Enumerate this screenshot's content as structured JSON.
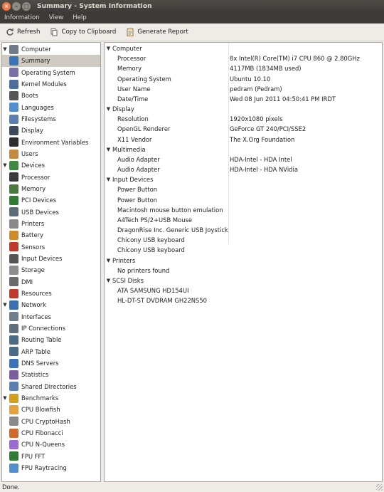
{
  "window": {
    "title": "Summary - System Information",
    "controls": [
      "×",
      "–",
      "□"
    ]
  },
  "menubar": [
    "Information",
    "View",
    "Help"
  ],
  "toolbar": [
    {
      "label": "Refresh",
      "icon": "refresh-icon"
    },
    {
      "label": "Copy to Clipboard",
      "icon": "clipboard-icon"
    },
    {
      "label": "Generate Report",
      "icon": "report-icon"
    }
  ],
  "sidebar": [
    {
      "label": "Computer",
      "level": 0,
      "expanded": true,
      "icon": "computer-icon",
      "color": "#6d7b8d"
    },
    {
      "label": "Summary",
      "level": 1,
      "selected": true,
      "icon": "info-icon",
      "color": "#3b73b9"
    },
    {
      "label": "Operating System",
      "level": 1,
      "icon": "gear-icon",
      "color": "#7a6fa8"
    },
    {
      "label": "Kernel Modules",
      "level": 1,
      "icon": "module-icon",
      "color": "#4b6e9c"
    },
    {
      "label": "Boots",
      "level": 1,
      "icon": "power-icon",
      "color": "#555555"
    },
    {
      "label": "Languages",
      "level": 1,
      "icon": "language-icon",
      "color": "#4f8fd0"
    },
    {
      "label": "Filesystems",
      "level": 1,
      "icon": "folder-icon",
      "color": "#5a7fb3"
    },
    {
      "label": "Display",
      "level": 1,
      "icon": "monitor-icon",
      "color": "#3e4a5c"
    },
    {
      "label": "Environment Variables",
      "level": 1,
      "icon": "terminal-icon",
      "color": "#2e2e2e"
    },
    {
      "label": "Users",
      "level": 1,
      "icon": "users-icon",
      "color": "#c48a3f"
    },
    {
      "label": "Devices",
      "level": 0,
      "expanded": true,
      "icon": "chip-icon",
      "color": "#3f8a3f"
    },
    {
      "label": "Processor",
      "level": 1,
      "icon": "processor-icon",
      "color": "#3a3a3a"
    },
    {
      "label": "Memory",
      "level": 1,
      "icon": "memory-icon",
      "color": "#4a7a3a"
    },
    {
      "label": "PCI Devices",
      "level": 1,
      "icon": "pci-icon",
      "color": "#2e7d32"
    },
    {
      "label": "USB Devices",
      "level": 1,
      "icon": "usb-icon",
      "color": "#5b6b7a"
    },
    {
      "label": "Printers",
      "level": 1,
      "icon": "printer-icon",
      "color": "#8a8a8a"
    },
    {
      "label": "Battery",
      "level": 1,
      "icon": "battery-icon",
      "color": "#d08a2a"
    },
    {
      "label": "Sensors",
      "level": 1,
      "icon": "sensor-icon",
      "color": "#c0392b"
    },
    {
      "label": "Input Devices",
      "level": 1,
      "icon": "keyboard-icon",
      "color": "#555555"
    },
    {
      "label": "Storage",
      "level": 1,
      "icon": "storage-icon",
      "color": "#8d8d8d"
    },
    {
      "label": "DMI",
      "level": 1,
      "icon": "dmi-icon",
      "color": "#6a6a6a"
    },
    {
      "label": "Resources",
      "level": 1,
      "icon": "resources-icon",
      "color": "#c0392b"
    },
    {
      "label": "Network",
      "level": 0,
      "expanded": true,
      "icon": "network-icon",
      "color": "#3b6fb0"
    },
    {
      "label": "Interfaces",
      "level": 1,
      "icon": "interfaces-icon",
      "color": "#6f7f8f"
    },
    {
      "label": "IP Connections",
      "level": 1,
      "icon": "connections-icon",
      "color": "#5f6f7f"
    },
    {
      "label": "Routing Table",
      "level": 1,
      "icon": "routing-icon",
      "color": "#4a6a8a"
    },
    {
      "label": "ARP Table",
      "level": 1,
      "icon": "arp-icon",
      "color": "#4a6a8a"
    },
    {
      "label": "DNS Servers",
      "level": 1,
      "icon": "dns-icon",
      "color": "#3b73b9"
    },
    {
      "label": "Statistics",
      "level": 1,
      "icon": "statistics-icon",
      "color": "#7a5fa0"
    },
    {
      "label": "Shared Directories",
      "level": 1,
      "icon": "shared-folder-icon",
      "color": "#5a7fb3"
    },
    {
      "label": "Benchmarks",
      "level": 0,
      "expanded": true,
      "icon": "benchmark-icon",
      "color": "#d4a017"
    },
    {
      "label": "CPU Blowfish",
      "level": 1,
      "icon": "blowfish-icon",
      "color": "#e8a23a"
    },
    {
      "label": "CPU CryptoHash",
      "level": 1,
      "icon": "cryptohash-icon",
      "color": "#8a8a8a"
    },
    {
      "label": "CPU Fibonacci",
      "level": 1,
      "icon": "fibonacci-icon",
      "color": "#d06a2a"
    },
    {
      "label": "CPU N-Queens",
      "level": 1,
      "icon": "nqueens-icon",
      "color": "#9a6ad0"
    },
    {
      "label": "FPU FFT",
      "level": 1,
      "icon": "fft-icon",
      "color": "#2e7d32"
    },
    {
      "label": "FPU Raytracing",
      "level": 1,
      "icon": "raytracing-icon",
      "color": "#4f8fd0"
    }
  ],
  "details": [
    {
      "section": "Computer",
      "items": [
        {
          "k": "Processor",
          "v": "8x Intel(R) Core(TM) i7 CPU        860  @ 2.80GHz"
        },
        {
          "k": "Memory",
          "v": "4117MB (1834MB used)"
        },
        {
          "k": "Operating System",
          "v": "Ubuntu 10.10"
        },
        {
          "k": "User Name",
          "v": "pedram (Pedram)"
        },
        {
          "k": "Date/Time",
          "v": "Wed 08 Jun 2011 04:50:41 PM IRDT"
        }
      ]
    },
    {
      "section": "Display",
      "items": [
        {
          "k": "Resolution",
          "v": "1920x1080 pixels"
        },
        {
          "k": "OpenGL Renderer",
          "v": "GeForce GT 240/PCI/SSE2"
        },
        {
          "k": "X11 Vendor",
          "v": "The X.Org Foundation"
        }
      ]
    },
    {
      "section": "Multimedia",
      "items": [
        {
          "k": "Audio Adapter",
          "v": "HDA-Intel - HDA Intel"
        },
        {
          "k": "Audio Adapter",
          "v": "HDA-Intel - HDA NVidia"
        }
      ]
    },
    {
      "section": "Input Devices",
      "items": [
        {
          "k": " Power Button",
          "v": ""
        },
        {
          "k": " Power Button",
          "v": ""
        },
        {
          "k": " Macintosh mouse button emulation",
          "v": ""
        },
        {
          "k": " A4Tech PS/2+USB Mouse",
          "v": ""
        },
        {
          "k": " DragonRise Inc.   Generic   USB  Joystick",
          "v": ""
        },
        {
          "k": " Chicony  USB keyboard",
          "v": ""
        },
        {
          "k": " Chicony  USB keyboard",
          "v": ""
        }
      ]
    },
    {
      "section": "Printers",
      "items": [
        {
          "k": "No printers found",
          "v": ""
        }
      ]
    },
    {
      "section": "SCSI Disks",
      "items": [
        {
          "k": "ATA SAMSUNG HD154UI",
          "v": ""
        },
        {
          "k": "HL-DT-ST DVDRAM GH22NS50",
          "v": ""
        }
      ]
    }
  ],
  "status": "Done."
}
